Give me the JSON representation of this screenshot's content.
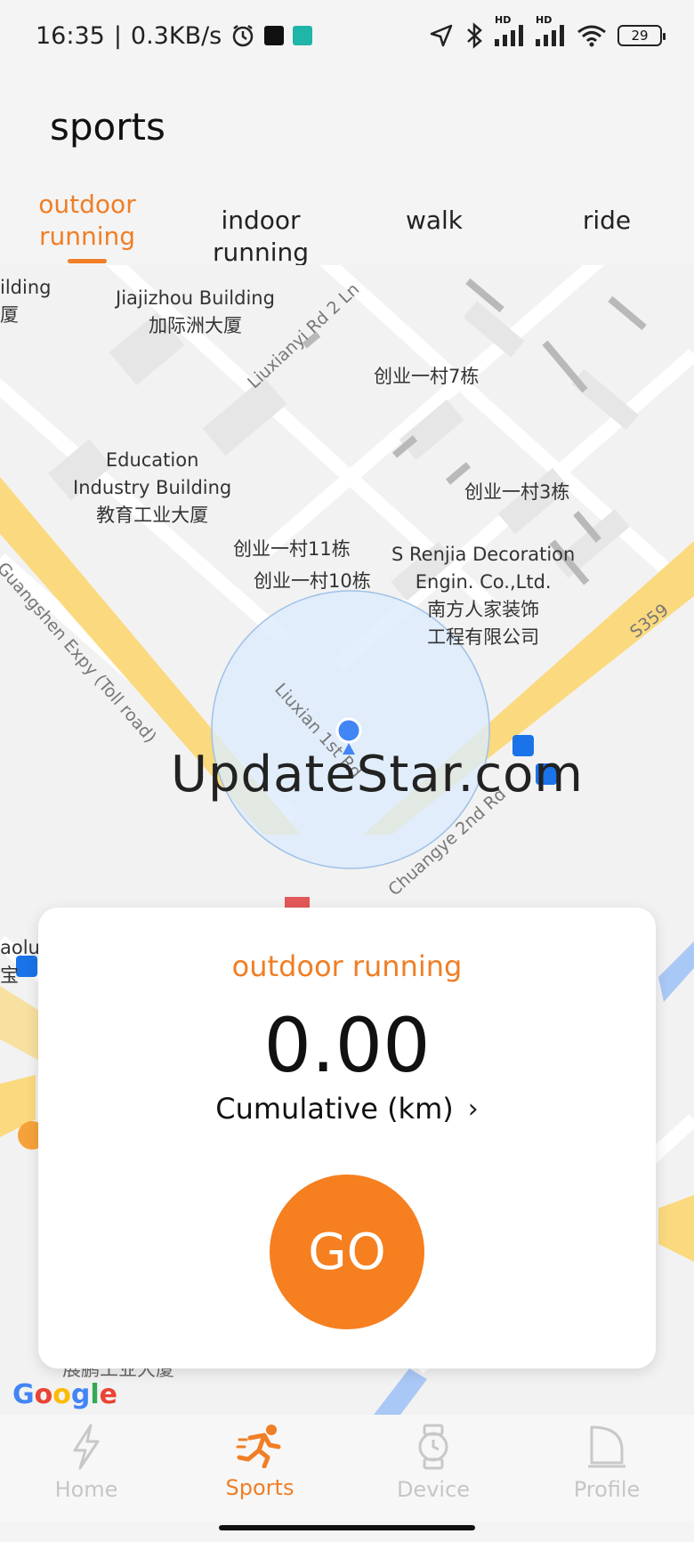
{
  "status_bar": {
    "time": "16:35",
    "net_speed": "0.3KB/s",
    "battery": "29",
    "network_badges": [
      "HD",
      "HD"
    ]
  },
  "header": {
    "title": "sports"
  },
  "tabs": [
    {
      "label": "outdoor running",
      "active": true
    },
    {
      "label": "indoor running",
      "active": false
    },
    {
      "label": "walk",
      "active": false
    },
    {
      "label": "ride",
      "active": false
    }
  ],
  "map": {
    "labels": {
      "building_left": "ilding\n厦",
      "jiajizhou": "Jiajizhou Building\n加际洲大厦",
      "liuxianyi_rd": "Liuxianyi Rd 2 Ln",
      "village_7": "创业一村7栋",
      "education": "Education\nIndustry Building\n教育工业大厦",
      "village_3": "创业一村3栋",
      "village_11": "创业一村11栋",
      "village_10": "创业一村10栋",
      "renjia": "S Renjia Decoration\nEngin. Co.,Ltd.\n南方人家装饰\n工程有限公司",
      "guangshen": "Guangshen Expy (Toll road)",
      "s359": "S359",
      "liuxian_rd": "Liuxian 1st Rd",
      "chuangye_rd": "Chuangye 2nd Rd",
      "baolu": "aolu\n宝",
      "bottom_building": "展鹏工业大厦"
    },
    "watermark": "UpdateStar.com",
    "google": [
      "G",
      "o",
      "o",
      "g",
      "l",
      "e"
    ],
    "google_colors": [
      "#4285F4",
      "#EA4335",
      "#FBBC05",
      "#4285F4",
      "#34A853",
      "#EA4335"
    ]
  },
  "card": {
    "sport": "outdoor running",
    "value": "0.00",
    "subtitle": "Cumulative (km)",
    "go_label": "GO"
  },
  "bottom_nav": [
    {
      "label": "Home",
      "icon": "lightning-icon",
      "active": false
    },
    {
      "label": "Sports",
      "icon": "runner-icon",
      "active": true
    },
    {
      "label": "Device",
      "icon": "watch-icon",
      "active": false
    },
    {
      "label": "Profile",
      "icon": "profile-icon",
      "active": false
    }
  ],
  "colors": {
    "accent": "#f07e25",
    "go_button": "#f67f20",
    "road_major": "#fbd97e",
    "accuracy_circle": "#dcebfb",
    "location_dot": "#4285f4",
    "inactive_nav": "#c6c6c6"
  }
}
